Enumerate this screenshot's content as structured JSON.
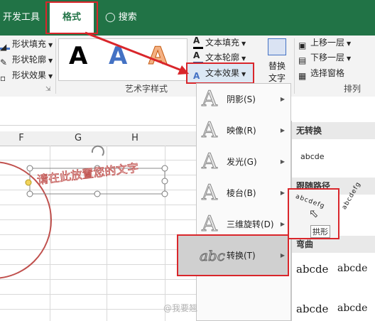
{
  "tabs": {
    "devtools": "开发工具",
    "format": "格式",
    "search": "搜索"
  },
  "ribbon": {
    "shape_fill": "形状填充",
    "shape_outline": "形状轮廓",
    "shape_effects": "形状效果",
    "wordart_samples": [
      "A",
      "A",
      "A"
    ],
    "text_fill": "文本填充",
    "text_outline": "文本轮廓",
    "text_effects": "文本效果",
    "alt_text_line1": "替换",
    "alt_text_line2": "文字",
    "bring_forward": "上移一层",
    "send_backward": "下移一层",
    "selection_pane": "选择窗格",
    "group_wordart": "艺术字样式",
    "group_arrange": "排列"
  },
  "sheet": {
    "columns": [
      "F",
      "G",
      "H"
    ],
    "textbox_text": "请在此放置您的文字"
  },
  "menu": {
    "items": [
      {
        "label": "阴影(S)",
        "glyph": "A"
      },
      {
        "label": "映像(R)",
        "glyph": "A"
      },
      {
        "label": "发光(G)",
        "glyph": "A"
      },
      {
        "label": "棱台(B)",
        "glyph": "A"
      },
      {
        "label": "三维旋转(D)",
        "glyph": "A"
      },
      {
        "label": "转换(T)",
        "glyph": "abc"
      }
    ]
  },
  "submenu": {
    "no_transform_header": "无转换",
    "no_transform_sample": "abcde",
    "follow_path_header": "跟随路径",
    "arch_sample": "abcdefg",
    "arch_sample_right": "abcdefg",
    "arch_tooltip": "拱形",
    "warp_header": "弯曲",
    "warp_samples": [
      "abcde",
      "abcde",
      "abcde",
      "abcde"
    ]
  },
  "watermark": "@我要翘",
  "colors": {
    "excel_green": "#217346",
    "highlight_red": "#d9262b",
    "wordart_blue": "#4472c4",
    "wordart_orange": "#f4b183"
  }
}
